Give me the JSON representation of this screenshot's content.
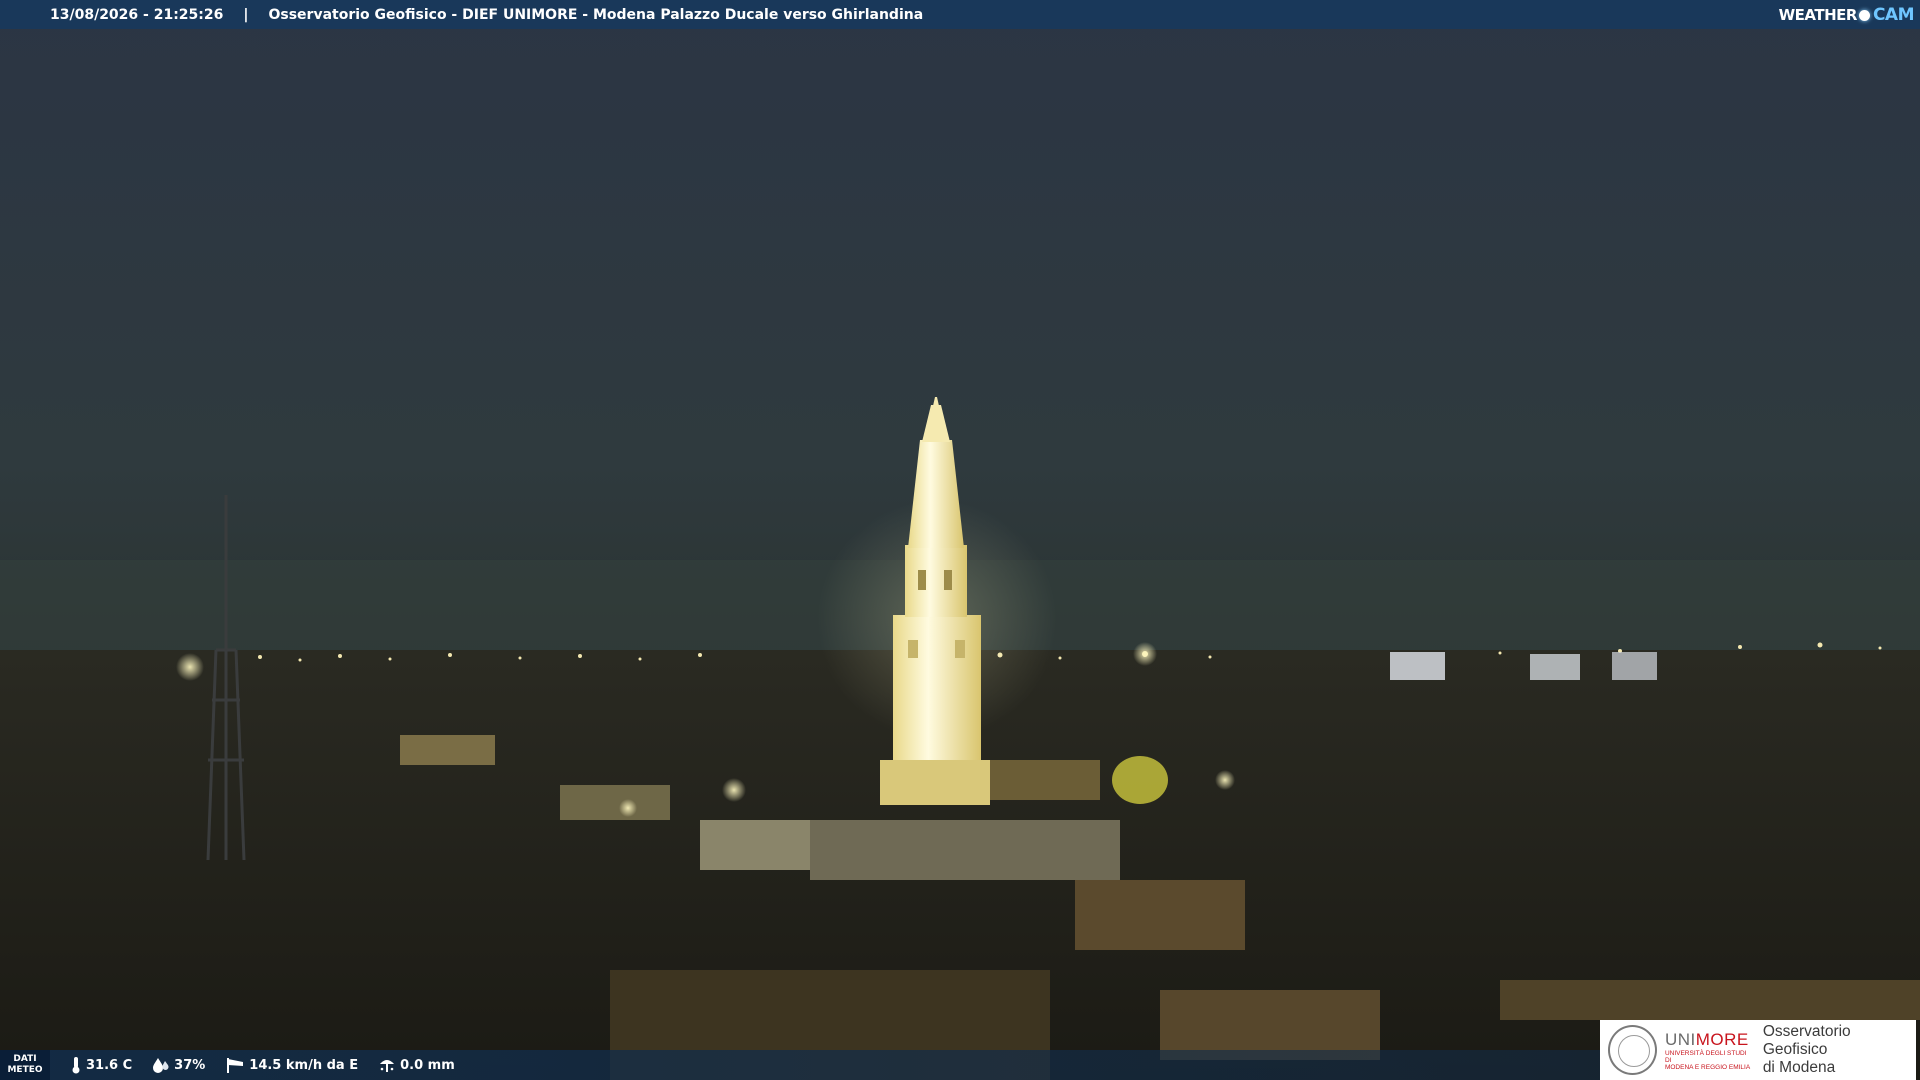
{
  "header": {
    "timestamp": "13/08/2026 - 21:25:26",
    "separator": "|",
    "title": "Osservatorio Geofisico - DIEF UNIMORE - Modena Palazzo Ducale verso Ghirlandina",
    "brand_left": "WEATHER",
    "brand_right": "CAM"
  },
  "weather_bar": {
    "label_line1": "DATI",
    "label_line2": "METEO",
    "temperature": "31.6 C",
    "humidity": "37%",
    "wind": "14.5 km/h da E",
    "rain": "0.0 mm",
    "icons": [
      "thermometer-icon",
      "humidity-drop-icon",
      "wind-sock-icon",
      "rain-gauge-icon"
    ]
  },
  "logo": {
    "uni_gray": "UNI",
    "uni_red": "MORE",
    "uni_sub_line1": "UNIVERSITÀ DEGLI STUDI DI",
    "uni_sub_line2": "MODENA E REGGIO EMILIA",
    "observatory_line1": "Osservatorio Geofisico",
    "observatory_line2": "di Modena"
  },
  "colors": {
    "bar_blue": "#18385c",
    "brand_cam": "#6fc6ff",
    "unimore_red": "#c8141d",
    "sky": "#2c3646",
    "tower_light": "#fff6c8"
  }
}
